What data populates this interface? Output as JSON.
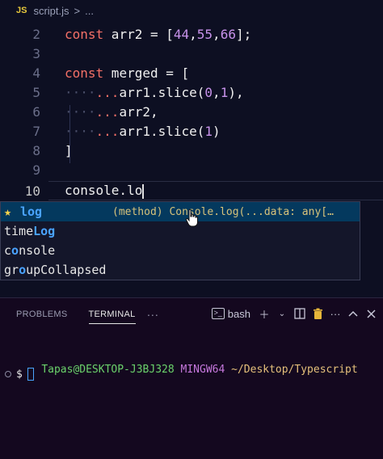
{
  "breadcrumb": {
    "file_badge": "JS",
    "file_name": "script.js",
    "separator": ">",
    "more": "..."
  },
  "editor": {
    "line_numbers": [
      "2",
      "3",
      "4",
      "5",
      "6",
      "7",
      "8",
      "9",
      "10"
    ],
    "line2": {
      "keyword": "const",
      "name": " arr2 = [",
      "v1": "44",
      "c1": ",",
      "v2": "55",
      "c2": ",",
      "v3": "66",
      "end": "];"
    },
    "line4": {
      "keyword": "const",
      "rest": " merged = ["
    },
    "line5": {
      "dots": "····",
      "spread": "...",
      "text": "arr1.slice(",
      "a": "0",
      "comma": ",",
      "b": "1",
      "end": "),"
    },
    "line6": {
      "dots": "····",
      "spread": "...",
      "text": "arr2,"
    },
    "line7": {
      "dots": "····",
      "spread": "...",
      "text": "arr1.slice(",
      "a": "1",
      "end": ")"
    },
    "line8": {
      "text": "]"
    },
    "line10": {
      "text": "console.lo"
    }
  },
  "suggest": {
    "items": [
      {
        "pre": "",
        "match": "log",
        "post": "",
        "detail": "(method) Console.log(...data: any[…"
      },
      {
        "pre": "time",
        "match": "Log",
        "post": ""
      },
      {
        "pre": "c",
        "match": "o",
        "post": "nsole"
      },
      {
        "pre": "gr",
        "match": "o",
        "post": "upCollapsed"
      }
    ]
  },
  "panel": {
    "tabs": [
      "PROBLEMS",
      "TERMINAL",
      "···"
    ],
    "shell": "bash",
    "terminal": {
      "user": "Tapas@DESKTOP-J3BJ328",
      "env": "MINGW64",
      "path": "~/Desktop/Typescript",
      "prompt": "$"
    }
  },
  "colors": {
    "background": "#0d0f22",
    "panel_bg": "#14081f",
    "keyword": "#f47067",
    "number": "#c792ea",
    "suggest_match": "#4aa3ff",
    "terminal_user": "#6bd26b"
  }
}
